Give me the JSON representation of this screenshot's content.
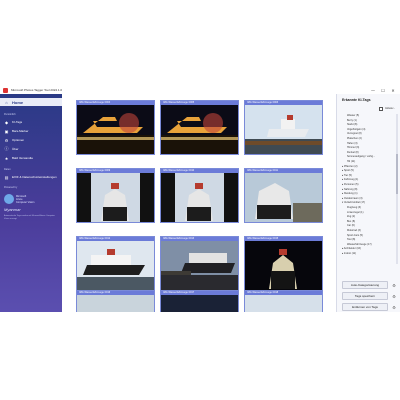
{
  "window": {
    "title": "Microsoft Photos Tagger Tool 2024.1.0",
    "minimize": "—",
    "maximize": "☐",
    "close": "✕"
  },
  "sidebar": {
    "nav": [
      {
        "label": "Home",
        "icon": "home-icon",
        "glyph": "⌂"
      },
      {
        "label": "KI-Tags",
        "icon": "tag-icon",
        "glyph": "◆"
      },
      {
        "label": "Bars-Marker",
        "icon": "marker-icon",
        "glyph": "▣"
      },
      {
        "label": "Optionen",
        "icon": "gear-icon",
        "glyph": "⚙"
      },
      {
        "label": "Über",
        "icon": "info-icon",
        "glyph": "ⓘ"
      },
      {
        "label": "Bald Verwandte",
        "icon": "star-icon",
        "glyph": "★"
      }
    ],
    "section_personal": "Persönlich",
    "section_data": "Daten",
    "data_item": "EXIF & Datenschutzeinstellungen",
    "section_powered": "Powered by",
    "logo_name": "Microsoft\nAzure\nComputer Vision",
    "logo_wordmark": "Myanmar",
    "footer": "Automatische Tags werden mit Microsoft Azure Computer Vision erzeugt."
  },
  "gallery": {
    "items": [
      {
        "label": "IMG Wasserfahrzeuge 0004",
        "scene": "night-port"
      },
      {
        "label": "IMG Wasserfahrzeuge 0005",
        "scene": "night-port"
      },
      {
        "label": "IMG Wasserfahrzeuge 0003",
        "scene": "day-ship"
      },
      {
        "label": "IMG Wasserfahrzeuge 0009",
        "scene": "bow"
      },
      {
        "label": "IMG Wasserfahrzeuge 0010",
        "scene": "bow"
      },
      {
        "label": "IMG Wasserfahrzeuge 0011",
        "scene": "bow-dock"
      },
      {
        "label": "IMG Wasserfahrzeuge 0012",
        "scene": "side"
      },
      {
        "label": "IMG Wasserfahrzeuge 0013",
        "scene": "dusk-side"
      },
      {
        "label": "IMG Wasserfahrzeuge 0015",
        "scene": "night-bow"
      },
      {
        "label": "IMG Wasserfahrzeuge 0016",
        "scene": "rocks"
      },
      {
        "label": "IMG Wasserfahrzeuge 0017",
        "scene": "dark"
      },
      {
        "label": "IMG Wasserfahrzeuge 0018",
        "scene": "sky"
      }
    ]
  },
  "tags": {
    "title": "Erkannte KI-Tags",
    "include_label": "Inklusiv...",
    "tree": [
      {
        "label": "Wasser (5)",
        "indent": 2
      },
      {
        "label": "Berry (1)",
        "indent": 2
      },
      {
        "label": "Starkt (8)",
        "indent": 2
      },
      {
        "label": "Vogelfortgeln (4)",
        "indent": 2
      },
      {
        "label": "Verregnet (8)",
        "indent": 2
      },
      {
        "label": "Platschen (2)",
        "indent": 2
      },
      {
        "label": "Hafen (3)",
        "indent": 2
      },
      {
        "label": "Himmel (3)",
        "indent": 2
      },
      {
        "label": "Dunkel (8)",
        "indent": 2
      },
      {
        "label": "Sonnenaufgang / vorhg... ",
        "indent": 2
      },
      {
        "label": "Hd (11)",
        "indent": 2
      },
      {
        "label": "▸ Pflanzen (2)",
        "indent": 0
      },
      {
        "label": "▸ Sport (5)",
        "indent": 0
      },
      {
        "label": "▸ Tier (5)",
        "indent": 0
      },
      {
        "label": "▸ Fahrzeug (1)",
        "indent": 0
      },
      {
        "label": "▸ Personen (5)",
        "indent": 0
      },
      {
        "label": "▸ Nahrung (8)",
        "indent": 0
      },
      {
        "label": "▸ Kleidung (1)",
        "indent": 0
      },
      {
        "label": "▸ Outdoorraum (3)",
        "indent": 0
      },
      {
        "label": "▾ Verkehrsmittel (17)",
        "indent": 0
      },
      {
        "label": "Flugzeug (3)",
        "indent": 2
      },
      {
        "label": "Linienzugel (1)",
        "indent": 2
      },
      {
        "label": "Zug (2)",
        "indent": 2
      },
      {
        "label": "Bus (8)",
        "indent": 2
      },
      {
        "label": "Car (6)",
        "indent": 2
      },
      {
        "label": "Motorrad (3)",
        "indent": 2
      },
      {
        "label": "Sport-Cars (5)",
        "indent": 2
      },
      {
        "label": "Taxi (8)",
        "indent": 2
      },
      {
        "label": "Wasserfahrzeuge (17)",
        "indent": 2
      },
      {
        "label": "▸ Architektur (16)",
        "indent": 0
      },
      {
        "label": "▸ Indoor (11)",
        "indent": 0
      }
    ],
    "buttons": [
      {
        "label": "Auto-Kategorisierung",
        "name": "auto-categorize-button"
      },
      {
        "label": "Tags speichern",
        "name": "save-tags-button"
      },
      {
        "label": "Entfernen von Tags",
        "name": "remove-tags-button"
      }
    ]
  }
}
